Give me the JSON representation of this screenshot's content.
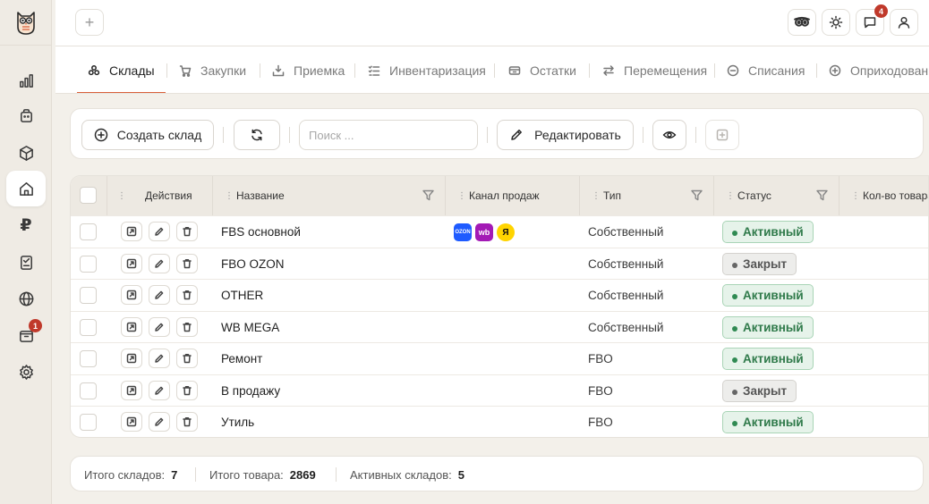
{
  "header": {
    "add_tab_label": "+",
    "notifications_count": "4"
  },
  "sidebar": {
    "currency_symbol": "₽",
    "orders_badge": "1"
  },
  "tabs": [
    {
      "label": "Склады",
      "icon": "warehouse-icon",
      "active": true
    },
    {
      "label": "Закупки",
      "icon": "purchases-icon"
    },
    {
      "label": "Приемка",
      "icon": "receiving-icon"
    },
    {
      "label": "Инвентаризация",
      "icon": "inventory-icon"
    },
    {
      "label": "Остатки",
      "icon": "stock-icon"
    },
    {
      "label": "Перемещения",
      "icon": "transfer-icon"
    },
    {
      "label": "Списания",
      "icon": "writeoff-icon"
    },
    {
      "label": "Оприходование",
      "icon": "posting-icon"
    }
  ],
  "toolbar": {
    "create_label": "Создать склад",
    "search_placeholder": "Поиск ...",
    "edit_label": "Редактировать"
  },
  "table": {
    "columns": {
      "actions": "Действия",
      "name": "Название",
      "channel": "Канал продаж",
      "type": "Тип",
      "status": "Статус",
      "qty": "Кол-во товара"
    },
    "channel_labels": {
      "ozon": "OZON",
      "wb": "wb",
      "ym": "Я"
    },
    "rows": [
      {
        "name": "FBS основной",
        "type": "Собственный",
        "status": "Активный",
        "status_kind": "active",
        "channels": true
      },
      {
        "name": "FBO OZON",
        "type": "Собственный",
        "status": "Закрыт",
        "status_kind": "closed",
        "channels": false
      },
      {
        "name": "OTHER",
        "type": "Собственный",
        "status": "Активный",
        "status_kind": "active",
        "channels": false
      },
      {
        "name": "WB MEGA",
        "type": "Собственный",
        "status": "Активный",
        "status_kind": "active",
        "channels": false
      },
      {
        "name": "Ремонт",
        "type": "FBO",
        "status": "Активный",
        "status_kind": "active",
        "channels": false
      },
      {
        "name": "В продажу",
        "type": "FBO",
        "status": "Закрыт",
        "status_kind": "closed",
        "channels": false
      },
      {
        "name": "Утиль",
        "type": "FBO",
        "status": "Активный",
        "status_kind": "active",
        "channels": false
      }
    ]
  },
  "footer": {
    "total_warehouses_label": "Итого складов:",
    "total_warehouses": "7",
    "total_goods_label": "Итого товара:",
    "total_goods": "2869",
    "active_warehouses_label": "Активных складов:",
    "active_warehouses": "5"
  },
  "colors": {
    "accent": "#d9603a",
    "active_status": "#2f7a4a",
    "badge": "#c0392b"
  }
}
